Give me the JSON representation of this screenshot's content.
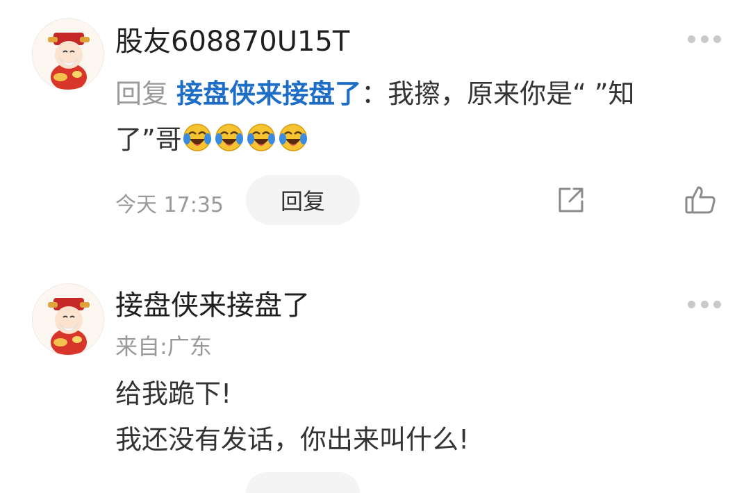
{
  "comments": [
    {
      "username": "股友608870U15T",
      "reply_prefix": "回复 ",
      "reply_to": "接盘侠来接盘了",
      "text_line1": "：我擦，原来你是“ ”知",
      "text_line2": "了”哥",
      "emoji_icon": "laughing-crying-emoji",
      "emoji_count": 4,
      "time": "今天 17:35",
      "reply_button_label": "回复"
    },
    {
      "username": "接盘侠来接盘了",
      "location": "来自:广东",
      "text_line1": "给我跪下!",
      "text_line2": "我还没有发话，你出来叫什么!"
    }
  ],
  "colors": {
    "mention": "#1e6ec8",
    "muted": "#999999",
    "reply_button_bg": "#f4f4f4"
  }
}
